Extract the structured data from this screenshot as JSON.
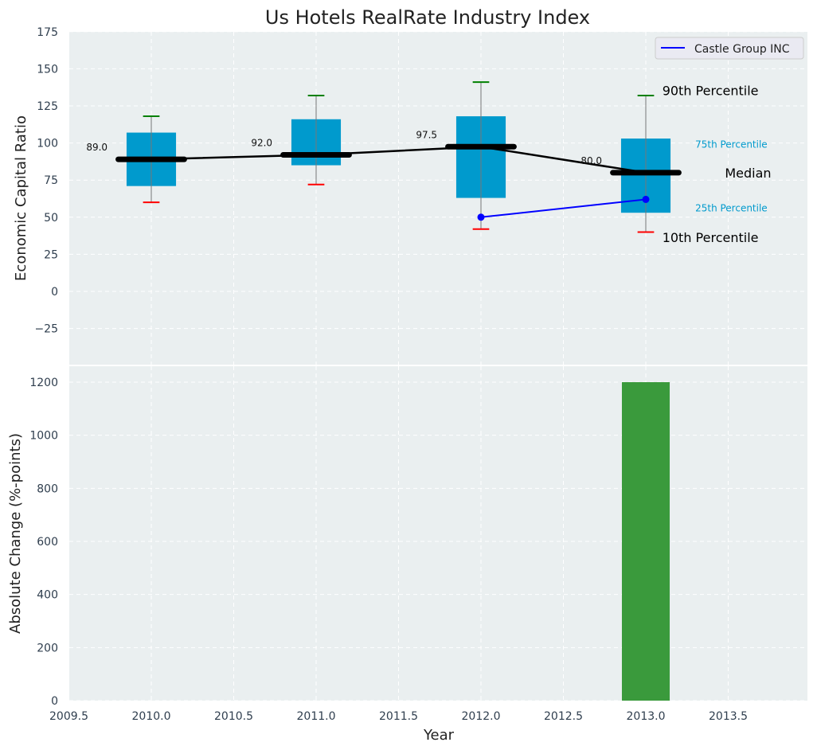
{
  "chart_data": [
    {
      "type": "box",
      "title": "Us Hotels RealRate Industry Index",
      "ylabel": "Economic Capital Ratio",
      "xlim": [
        2009.5,
        2013.97
      ],
      "ylim": [
        -49.5,
        175
      ],
      "yticks": [
        -25,
        0,
        25,
        50,
        75,
        100,
        125,
        150,
        175
      ],
      "grid": true,
      "categories": [
        2010,
        2011,
        2012,
        2013
      ],
      "p10": [
        60,
        72,
        42,
        40
      ],
      "p25": [
        71,
        85,
        63,
        53
      ],
      "median": [
        89.0,
        92.0,
        97.5,
        80.0
      ],
      "median_labels": [
        "89.0",
        "92.0",
        "97.5",
        "80.0"
      ],
      "p75": [
        107,
        116,
        118,
        103
      ],
      "p90": [
        118,
        132,
        141,
        132
      ],
      "series": [
        {
          "name": "Castle Group INC",
          "x": [
            2012,
            2013
          ],
          "values": [
            50,
            62
          ],
          "color": "#0000ff"
        }
      ],
      "legend": {
        "position": "top-right",
        "entries": [
          "Castle Group INC"
        ]
      },
      "annotations": {
        "p90": "90th Percentile",
        "p75": "75th Percentile",
        "median": "Median",
        "p25": "25th Percentile",
        "p10": "10th Percentile"
      },
      "colors": {
        "box": "#009acd",
        "p90": "#008000",
        "p10": "#ff0000",
        "median": "#000000"
      }
    },
    {
      "type": "bar",
      "xlabel": "Year",
      "ylabel": "Absolute Change (%-points)",
      "xlim": [
        2009.5,
        2013.97
      ],
      "ylim": [
        0,
        1260
      ],
      "xticks": [
        "2009.5",
        "2010.0",
        "2010.5",
        "2011.0",
        "2011.5",
        "2012.0",
        "2012.5",
        "2013.0",
        "2013.5"
      ],
      "yticks": [
        0,
        200,
        400,
        600,
        800,
        1000,
        1200
      ],
      "x": [
        2013
      ],
      "values": [
        1200
      ],
      "color": "#3a9a3c",
      "grid": true
    }
  ]
}
